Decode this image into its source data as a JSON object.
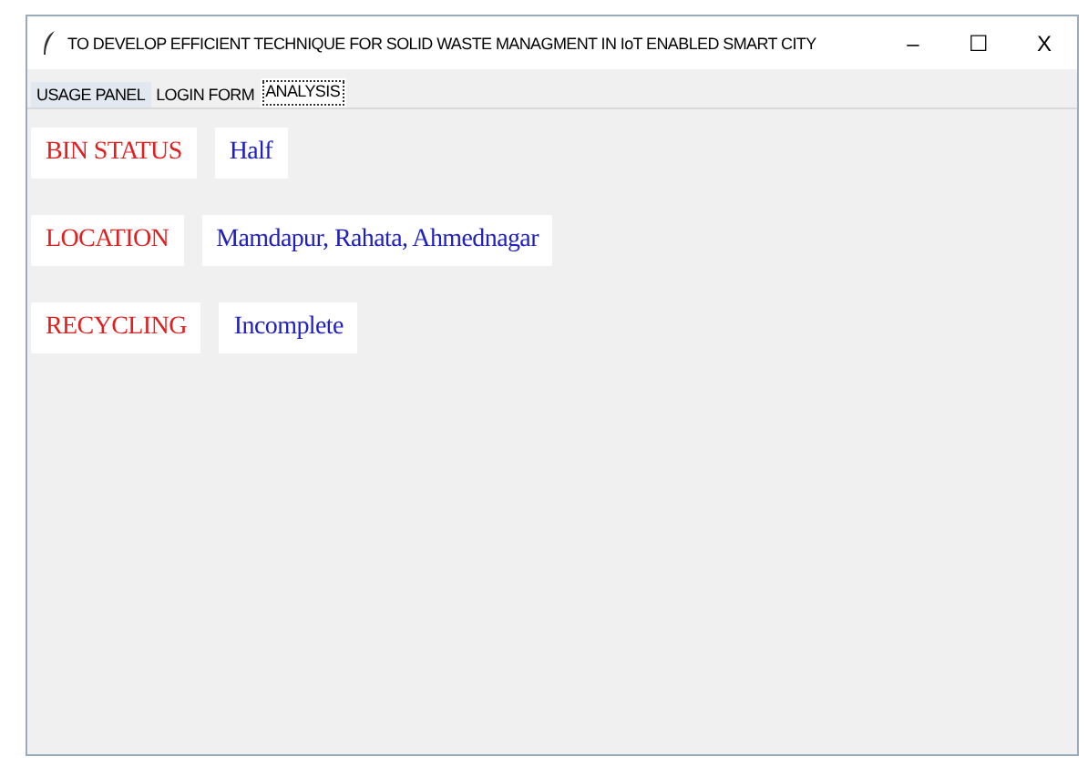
{
  "window": {
    "title": "TO DEVELOP EFFICIENT TECHNIQUE FOR SOLID WASTE MANAGMENT IN IoT ENABLED SMART CITY",
    "controls": [
      "–",
      "☐",
      "X"
    ]
  },
  "tabs": [
    {
      "label": "USAGE PANEL",
      "selected": false
    },
    {
      "label": "LOGIN FORM",
      "selected": false
    },
    {
      "label": "ANALYSIS",
      "selected": true
    }
  ],
  "fields": [
    {
      "label": "BIN STATUS",
      "value": "Half"
    },
    {
      "label": "LOCATION",
      "value": "Mamdapur, Rahata, Ahmednagar"
    },
    {
      "label": "RECYCLING",
      "value": "Incomplete"
    }
  ]
}
